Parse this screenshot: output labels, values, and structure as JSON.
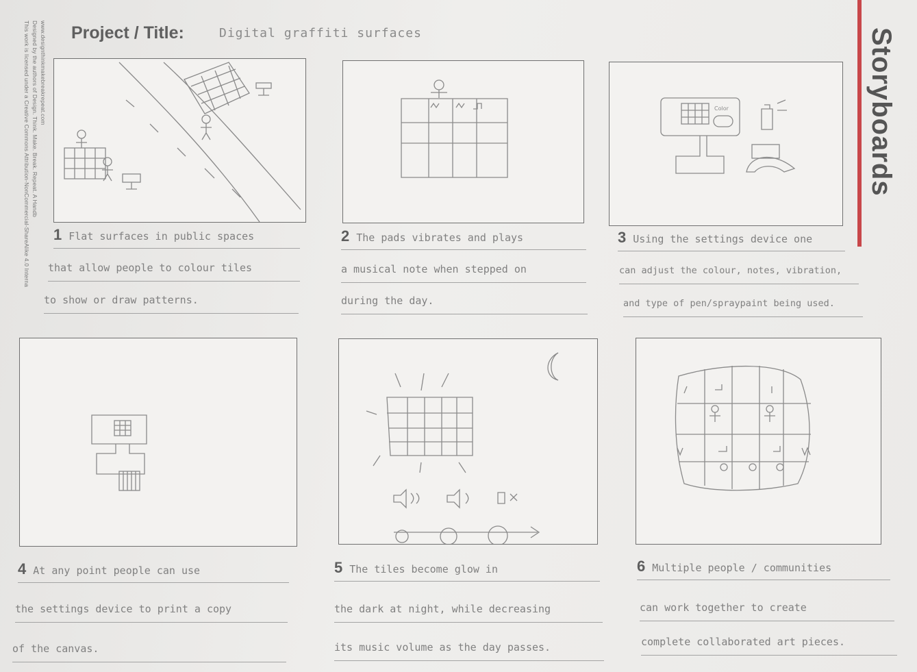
{
  "side_note": [
    "This work is licensed under a Creative Commons Attribution-NonCommercial-ShareAlike 4.0 Interna",
    "Designed by the authors of Design. Think. Make. Break. Repeat. A Handb",
    "www.designthinkmakebreakrepeat.com"
  ],
  "header": {
    "title_label": "Project / Title:",
    "title_value": "Digital graffiti surfaces",
    "heading": "Storyboards"
  },
  "panels": [
    {
      "number": "1",
      "lines": [
        "Flat surfaces in public spaces",
        "that allow people to colour tiles",
        "to show or draw patterns."
      ]
    },
    {
      "number": "2",
      "lines": [
        "The pads vibrates and plays",
        "a musical note when stepped on",
        "during the day."
      ]
    },
    {
      "number": "3",
      "lines": [
        "Using the settings device one",
        "can adjust the colour, notes, vibration,",
        "and type of pen/spraypaint being used."
      ]
    },
    {
      "number": "4",
      "lines": [
        "At any point people can use",
        "the settings device to print a copy",
        "of the canvas."
      ]
    },
    {
      "number": "5",
      "lines": [
        "The tiles become glow in",
        "the dark at night, while decreasing",
        "its music volume as the day passes."
      ]
    },
    {
      "number": "6",
      "lines": [
        "Multiple people / communities",
        "can work together to create",
        "complete collaborated art pieces."
      ]
    }
  ],
  "sketch_labels": {
    "color_label": "Color"
  },
  "colors": {
    "accent": "#c8474a",
    "ink": "#6d6d6d",
    "paper": "#ebeae8"
  }
}
